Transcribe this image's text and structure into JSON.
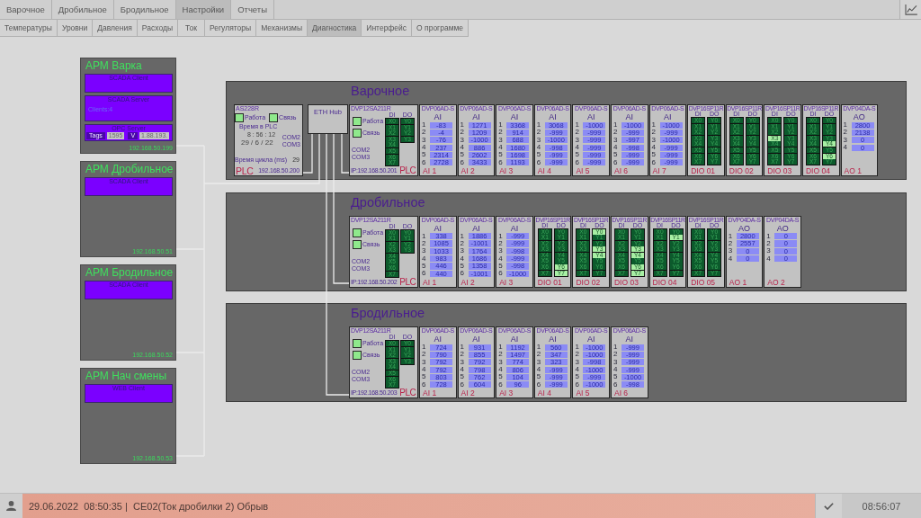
{
  "nav": {
    "tabs": [
      {
        "label": "Варочное",
        "selected": false
      },
      {
        "label": "Дробильное",
        "selected": false
      },
      {
        "label": "Бродильное",
        "selected": false
      },
      {
        "label": "Настройки",
        "selected": true
      },
      {
        "label": "Отчеты",
        "selected": false
      }
    ],
    "subtabs": [
      {
        "label": "Температуры",
        "selected": false
      },
      {
        "label": "Уровни",
        "selected": false
      },
      {
        "label": "Давления",
        "selected": false
      },
      {
        "label": "Расходы",
        "selected": false
      },
      {
        "label": "Ток",
        "selected": false
      },
      {
        "label": "Регуляторы",
        "selected": false
      },
      {
        "label": "Механизмы",
        "selected": false
      },
      {
        "label": "Диагностика",
        "selected": true
      },
      {
        "label": "Интерфейс",
        "selected": false
      },
      {
        "label": "О программе",
        "selected": false
      }
    ]
  },
  "workstations": [
    {
      "title": "АРМ Варка",
      "services": [
        {
          "kind": "basic",
          "name": "SCADA Client"
        },
        {
          "kind": "server",
          "name": "SCADA Server",
          "info": "Clients:4"
        },
        {
          "kind": "opc",
          "name": "OPC Server",
          "tags_label": "Tags",
          "tags": "1595",
          "version_label": "V",
          "version": "1.88.193."
        }
      ],
      "ip": "192.168.50.199"
    },
    {
      "title": "АРМ Дробильное",
      "services": [
        {
          "kind": "basic",
          "name": "SCADA Client"
        }
      ],
      "ip": "192.168.50.51"
    },
    {
      "title": "АРМ Бродильное",
      "services": [
        {
          "kind": "basic",
          "name": "SCADA Client"
        }
      ],
      "ip": "192.168.50.52"
    },
    {
      "title": "АРМ Нач смены",
      "services": [
        {
          "kind": "basic",
          "name": "WEB Client"
        }
      ],
      "ip": "192.168.50.53"
    }
  ],
  "sections": [
    {
      "title": "Варочное",
      "gateway": {
        "model": "AS228R",
        "statuses": [
          {
            "label": "Работа",
            "on": true
          },
          {
            "label": "Связь",
            "on": true
          }
        ],
        "clock_label": "Время в PLC",
        "time": "8 : 56 : 12",
        "date": "29 / 6 / 22",
        "ports": [
          "COM2",
          "COM3"
        ],
        "cycle_label": "Время цикла (ms)",
        "cycle": "29",
        "tag": "PLC",
        "ip": "192.168.50.200"
      },
      "hub": {
        "label": "ETH Hub"
      },
      "plc": {
        "model": "DVP12SA211R",
        "di_label": "DI",
        "do_label": "DO",
        "statuses": [
          {
            "label": "Работа",
            "on": true
          },
          {
            "label": "Связь",
            "on": true
          }
        ],
        "ports": [
          "COM2",
          "COM3"
        ],
        "inputs": [
          {
            "label": "X0",
            "on": false
          },
          {
            "label": "X1",
            "on": false
          },
          {
            "label": "X2",
            "on": false
          },
          {
            "label": "X3",
            "on": false
          },
          {
            "label": "X4",
            "on": false
          },
          {
            "label": "X5",
            "on": false
          },
          {
            "label": "X6",
            "on": false
          },
          {
            "label": "X7",
            "on": false
          }
        ],
        "outputs": [
          {
            "label": "Y0",
            "on": false
          },
          {
            "label": "Y1",
            "on": false
          },
          {
            "label": "Y2",
            "on": false
          },
          {
            "label": "Y3",
            "on": false
          }
        ],
        "ip": "IP:192.168.50.201",
        "tag": "PLC"
      },
      "modules": [
        {
          "kind": "analog",
          "model": "DVP06AD-S",
          "type": "AI",
          "channels": [
            {
              "n": "1",
              "value": "-83"
            },
            {
              "n": "2",
              "value": "-4"
            },
            {
              "n": "3",
              "value": "-76"
            },
            {
              "n": "4",
              "value": "237"
            },
            {
              "n": "5",
              "value": "2314"
            },
            {
              "n": "6",
              "value": "2728"
            }
          ],
          "label": "AI 1"
        },
        {
          "kind": "analog",
          "model": "DVP06AD-S",
          "type": "AI",
          "channels": [
            {
              "n": "1",
              "value": "1271"
            },
            {
              "n": "2",
              "value": "1209"
            },
            {
              "n": "3",
              "value": "-1000"
            },
            {
              "n": "4",
              "value": "886"
            },
            {
              "n": "5",
              "value": "2602"
            },
            {
              "n": "6",
              "value": "3433"
            }
          ],
          "label": "AI 2"
        },
        {
          "kind": "analog",
          "model": "DVP06AD-S",
          "type": "AI",
          "channels": [
            {
              "n": "1",
              "value": "3368"
            },
            {
              "n": "2",
              "value": "914"
            },
            {
              "n": "3",
              "value": "688"
            },
            {
              "n": "4",
              "value": "1680"
            },
            {
              "n": "5",
              "value": "1698"
            },
            {
              "n": "6",
              "value": "1193"
            }
          ],
          "label": "AI 3"
        },
        {
          "kind": "analog",
          "model": "DVP06AD-S",
          "type": "AI",
          "channels": [
            {
              "n": "1",
              "value": "3068"
            },
            {
              "n": "2",
              "value": "-999"
            },
            {
              "n": "3",
              "value": "-1000"
            },
            {
              "n": "4",
              "value": "-998"
            },
            {
              "n": "5",
              "value": "-999"
            },
            {
              "n": "6",
              "value": "-999"
            }
          ],
          "label": "AI 4"
        },
        {
          "kind": "analog",
          "model": "DVP06AD-S",
          "type": "AI",
          "channels": [
            {
              "n": "1",
              "value": "-1000"
            },
            {
              "n": "2",
              "value": "-999"
            },
            {
              "n": "3",
              "value": "-999"
            },
            {
              "n": "4",
              "value": "-999"
            },
            {
              "n": "5",
              "value": "-999"
            },
            {
              "n": "6",
              "value": "-999"
            }
          ],
          "label": "AI 5"
        },
        {
          "kind": "analog",
          "model": "DVP06AD-S",
          "type": "AI",
          "channels": [
            {
              "n": "1",
              "value": "-1000"
            },
            {
              "n": "2",
              "value": "-999"
            },
            {
              "n": "3",
              "value": "-997"
            },
            {
              "n": "4",
              "value": "-998"
            },
            {
              "n": "5",
              "value": "-999"
            },
            {
              "n": "6",
              "value": "-999"
            }
          ],
          "label": "AI 6"
        },
        {
          "kind": "analog",
          "model": "DVP06AD-S",
          "type": "AI",
          "channels": [
            {
              "n": "1",
              "value": "-1000"
            },
            {
              "n": "2",
              "value": "-999"
            },
            {
              "n": "3",
              "value": "-1000"
            },
            {
              "n": "4",
              "value": "-999"
            },
            {
              "n": "5",
              "value": "-999"
            },
            {
              "n": "6",
              "value": "-999"
            }
          ],
          "label": "AI 7"
        },
        {
          "kind": "digital",
          "model": "DVP16SP11R",
          "di_label": "DI",
          "do_label": "DO",
          "inputs": [
            {
              "label": "X0",
              "on": false
            },
            {
              "label": "X1",
              "on": false
            },
            {
              "label": "X2",
              "on": false
            },
            {
              "label": "X3",
              "on": false
            },
            {
              "label": "X4",
              "on": false
            },
            {
              "label": "X5",
              "on": false
            },
            {
              "label": "X6",
              "on": false
            },
            {
              "label": "X7",
              "on": false
            }
          ],
          "outputs": [
            {
              "label": "Y0",
              "on": false
            },
            {
              "label": "Y1",
              "on": false
            },
            {
              "label": "Y2",
              "on": false
            },
            {
              "label": "Y3",
              "on": false
            },
            {
              "label": "Y4",
              "on": false
            },
            {
              "label": "Y5",
              "on": false
            },
            {
              "label": "Y6",
              "on": false
            },
            {
              "label": "Y7",
              "on": false
            }
          ],
          "label": "DIO 01"
        },
        {
          "kind": "digital",
          "model": "DVP16SP11R",
          "di_label": "DI",
          "do_label": "DO",
          "inputs": [
            {
              "label": "X0",
              "on": false
            },
            {
              "label": "X1",
              "on": false
            },
            {
              "label": "X2",
              "on": false
            },
            {
              "label": "X3",
              "on": false
            },
            {
              "label": "X4",
              "on": false
            },
            {
              "label": "X5",
              "on": false
            },
            {
              "label": "X6",
              "on": false
            },
            {
              "label": "X7",
              "on": false
            }
          ],
          "outputs": [
            {
              "label": "Y0",
              "on": false
            },
            {
              "label": "Y1",
              "on": false
            },
            {
              "label": "Y2",
              "on": false
            },
            {
              "label": "Y3",
              "on": false
            },
            {
              "label": "Y4",
              "on": false
            },
            {
              "label": "Y5",
              "on": false
            },
            {
              "label": "Y6",
              "on": false
            },
            {
              "label": "Y7",
              "on": false
            }
          ],
          "label": "DIO 02"
        },
        {
          "kind": "digital",
          "model": "DVP16SP11R",
          "di_label": "DI",
          "do_label": "DO",
          "inputs": [
            {
              "label": "X0",
              "on": false
            },
            {
              "label": "X1",
              "on": false
            },
            {
              "label": "X2",
              "on": false
            },
            {
              "label": "X3",
              "on": true
            },
            {
              "label": "X4",
              "on": false
            },
            {
              "label": "X5",
              "on": false
            },
            {
              "label": "X6",
              "on": false
            },
            {
              "label": "X7",
              "on": false
            }
          ],
          "outputs": [
            {
              "label": "Y0",
              "on": false
            },
            {
              "label": "Y1",
              "on": false
            },
            {
              "label": "Y2",
              "on": false
            },
            {
              "label": "Y3",
              "on": false
            },
            {
              "label": "Y4",
              "on": false
            },
            {
              "label": "Y5",
              "on": false
            },
            {
              "label": "Y6",
              "on": false
            },
            {
              "label": "Y7",
              "on": false
            }
          ],
          "label": "DIO 03"
        },
        {
          "kind": "digital",
          "model": "DVP16SP11R",
          "di_label": "DI",
          "do_label": "DO",
          "inputs": [
            {
              "label": "X0",
              "on": false
            },
            {
              "label": "X1",
              "on": false
            },
            {
              "label": "X2",
              "on": false
            },
            {
              "label": "X3",
              "on": false
            },
            {
              "label": "X4",
              "on": false
            },
            {
              "label": "X5",
              "on": false
            },
            {
              "label": "X6",
              "on": false
            },
            {
              "label": "X7",
              "on": false
            }
          ],
          "outputs": [
            {
              "label": "Y0",
              "on": false
            },
            {
              "label": "Y1",
              "on": false
            },
            {
              "label": "Y2",
              "on": false
            },
            {
              "label": "Y3",
              "on": false
            },
            {
              "label": "Y4",
              "on": true
            },
            {
              "label": "Y5",
              "on": false
            },
            {
              "label": "Y6",
              "on": true
            },
            {
              "label": "Y7",
              "on": false
            }
          ],
          "label": "DIO 04"
        },
        {
          "kind": "analog",
          "model": "DVP04DA-S",
          "type": "AO",
          "channels": [
            {
              "n": "1",
              "value": "2800"
            },
            {
              "n": "2",
              "value": "2138"
            },
            {
              "n": "3",
              "value": "0"
            },
            {
              "n": "4",
              "value": "0"
            }
          ],
          "label": "AO 1"
        }
      ]
    },
    {
      "title": "Дробильное",
      "plc": {
        "model": "DVP12SA211R",
        "di_label": "DI",
        "do_label": "DO",
        "statuses": [
          {
            "label": "Работа",
            "on": true
          },
          {
            "label": "Связь",
            "on": true
          }
        ],
        "ports": [
          "COM2",
          "COM3"
        ],
        "inputs": [
          {
            "label": "X0",
            "on": false
          },
          {
            "label": "X1",
            "on": false
          },
          {
            "label": "X2",
            "on": false
          },
          {
            "label": "X3",
            "on": false
          },
          {
            "label": "X4",
            "on": false
          },
          {
            "label": "X5",
            "on": false
          },
          {
            "label": "X6",
            "on": false
          },
          {
            "label": "X7",
            "on": false
          }
        ],
        "outputs": [
          {
            "label": "Y0",
            "on": false
          },
          {
            "label": "Y1",
            "on": false
          },
          {
            "label": "Y2",
            "on": false
          },
          {
            "label": "Y3",
            "on": false
          }
        ],
        "ip": "IP:192.168.50.202",
        "tag": "PLC"
      },
      "modules": [
        {
          "kind": "analog",
          "model": "DVP06AD-S",
          "type": "AI",
          "channels": [
            {
              "n": "1",
              "value": "338"
            },
            {
              "n": "2",
              "value": "1085"
            },
            {
              "n": "3",
              "value": "1033"
            },
            {
              "n": "4",
              "value": "983"
            },
            {
              "n": "5",
              "value": "446"
            },
            {
              "n": "6",
              "value": "440"
            }
          ],
          "label": "AI 1"
        },
        {
          "kind": "analog",
          "model": "DVP06AD-S",
          "type": "AI",
          "channels": [
            {
              "n": "1",
              "value": "1886"
            },
            {
              "n": "2",
              "value": "-1001"
            },
            {
              "n": "3",
              "value": "1764"
            },
            {
              "n": "4",
              "value": "1686"
            },
            {
              "n": "5",
              "value": "1358"
            },
            {
              "n": "6",
              "value": "-1001"
            }
          ],
          "label": "AI 2"
        },
        {
          "kind": "analog",
          "model": "DVP06AD-S",
          "type": "AI",
          "channels": [
            {
              "n": "1",
              "value": "-999"
            },
            {
              "n": "2",
              "value": "-999"
            },
            {
              "n": "3",
              "value": "-998"
            },
            {
              "n": "4",
              "value": "-999"
            },
            {
              "n": "5",
              "value": "-998"
            },
            {
              "n": "6",
              "value": "-1000"
            }
          ],
          "label": "AI 3"
        },
        {
          "kind": "digital",
          "model": "DVP16SP11R",
          "di_label": "DI",
          "do_label": "DO",
          "inputs": [
            {
              "label": "X0",
              "on": false
            },
            {
              "label": "X1",
              "on": false
            },
            {
              "label": "X2",
              "on": false
            },
            {
              "label": "X3",
              "on": false
            },
            {
              "label": "X4",
              "on": false
            },
            {
              "label": "X5",
              "on": false
            },
            {
              "label": "X6",
              "on": false
            },
            {
              "label": "X7",
              "on": false
            }
          ],
          "outputs": [
            {
              "label": "Y0",
              "on": false
            },
            {
              "label": "Y1",
              "on": false
            },
            {
              "label": "Y2",
              "on": false
            },
            {
              "label": "Y3",
              "on": false
            },
            {
              "label": "Y4",
              "on": false
            },
            {
              "label": "Y5",
              "on": false
            },
            {
              "label": "Y6",
              "on": true
            },
            {
              "label": "Y7",
              "on": true
            }
          ],
          "label": "DIO 01"
        },
        {
          "kind": "digital",
          "model": "DVP16SP11R",
          "di_label": "DI",
          "do_label": "DO",
          "inputs": [
            {
              "label": "X0",
              "on": false
            },
            {
              "label": "X1",
              "on": false
            },
            {
              "label": "X2",
              "on": false
            },
            {
              "label": "X3",
              "on": false
            },
            {
              "label": "X4",
              "on": false
            },
            {
              "label": "X5",
              "on": false
            },
            {
              "label": "X6",
              "on": false
            },
            {
              "label": "X7",
              "on": false
            }
          ],
          "outputs": [
            {
              "label": "Y0",
              "on": true
            },
            {
              "label": "Y1",
              "on": false
            },
            {
              "label": "Y2",
              "on": false
            },
            {
              "label": "Y3",
              "on": true
            },
            {
              "label": "Y4",
              "on": true
            },
            {
              "label": "Y5",
              "on": false
            },
            {
              "label": "Y6",
              "on": false
            },
            {
              "label": "Y7",
              "on": false
            }
          ],
          "label": "DIO 02"
        },
        {
          "kind": "digital",
          "model": "DVP16SP11R",
          "di_label": "DI",
          "do_label": "DO",
          "inputs": [
            {
              "label": "X0",
              "on": false
            },
            {
              "label": "X1",
              "on": false
            },
            {
              "label": "X2",
              "on": false
            },
            {
              "label": "X3",
              "on": false
            },
            {
              "label": "X4",
              "on": false
            },
            {
              "label": "X5",
              "on": false
            },
            {
              "label": "X6",
              "on": false
            },
            {
              "label": "X7",
              "on": false
            }
          ],
          "outputs": [
            {
              "label": "Y0",
              "on": false
            },
            {
              "label": "Y1",
              "on": false
            },
            {
              "label": "Y2",
              "on": false
            },
            {
              "label": "Y3",
              "on": true
            },
            {
              "label": "Y4",
              "on": true
            },
            {
              "label": "Y5",
              "on": false
            },
            {
              "label": "Y6",
              "on": true
            },
            {
              "label": "Y7",
              "on": true
            }
          ],
          "label": "DIO 03"
        },
        {
          "kind": "digital",
          "model": "DVP16SP11R",
          "di_label": "DI",
          "do_label": "DO",
          "inputs": [
            {
              "label": "X0",
              "on": false
            },
            {
              "label": "X1",
              "on": false
            },
            {
              "label": "X2",
              "on": false
            },
            {
              "label": "X3",
              "on": false
            },
            {
              "label": "X4",
              "on": false
            },
            {
              "label": "X5",
              "on": false
            },
            {
              "label": "X6",
              "on": false
            },
            {
              "label": "X7",
              "on": false
            }
          ],
          "outputs": [
            {
              "label": "Y0",
              "on": false
            },
            {
              "label": "Y1",
              "on": true
            },
            {
              "label": "Y2",
              "on": false
            },
            {
              "label": "Y3",
              "on": false
            },
            {
              "label": "Y4",
              "on": false
            },
            {
              "label": "Y5",
              "on": false
            },
            {
              "label": "Y6",
              "on": false
            },
            {
              "label": "Y7",
              "on": false
            }
          ],
          "label": "DIO 04"
        },
        {
          "kind": "digital",
          "model": "DVP16SP11R",
          "di_label": "DI",
          "do_label": "DO",
          "inputs": [
            {
              "label": "X0",
              "on": false
            },
            {
              "label": "X1",
              "on": false
            },
            {
              "label": "X2",
              "on": false
            },
            {
              "label": "X3",
              "on": false
            },
            {
              "label": "X4",
              "on": false
            },
            {
              "label": "X5",
              "on": false
            },
            {
              "label": "X6",
              "on": false
            },
            {
              "label": "X7",
              "on": false
            }
          ],
          "outputs": [
            {
              "label": "Y0",
              "on": false
            },
            {
              "label": "Y1",
              "on": false
            },
            {
              "label": "Y2",
              "on": false
            },
            {
              "label": "Y3",
              "on": false
            },
            {
              "label": "Y4",
              "on": false
            },
            {
              "label": "Y5",
              "on": false
            },
            {
              "label": "Y6",
              "on": false
            },
            {
              "label": "Y7",
              "on": false
            }
          ],
          "label": "DIO 05"
        },
        {
          "kind": "analog",
          "model": "DVP04DA-S",
          "type": "AO",
          "channels": [
            {
              "n": "1",
              "value": "2800"
            },
            {
              "n": "2",
              "value": "2557"
            },
            {
              "n": "3",
              "value": "0"
            },
            {
              "n": "4",
              "value": "0"
            }
          ],
          "label": "AO 1"
        },
        {
          "kind": "analog",
          "model": "DVP04DA-S",
          "type": "AO",
          "channels": [
            {
              "n": "1",
              "value": "0"
            },
            {
              "n": "2",
              "value": "0"
            },
            {
              "n": "3",
              "value": "0"
            },
            {
              "n": "4",
              "value": "0"
            }
          ],
          "label": "AO 2"
        }
      ]
    },
    {
      "title": "Бродильное",
      "plc": {
        "model": "DVP12SA211R",
        "di_label": "DI",
        "do_label": "DO",
        "statuses": [
          {
            "label": "Работа",
            "on": true
          },
          {
            "label": "Связь",
            "on": true
          }
        ],
        "ports": [
          "COM2",
          "COM3"
        ],
        "inputs": [
          {
            "label": "X0",
            "on": false
          },
          {
            "label": "X1",
            "on": false
          },
          {
            "label": "X2",
            "on": false
          },
          {
            "label": "X3",
            "on": false
          },
          {
            "label": "X4",
            "on": false
          },
          {
            "label": "X5",
            "on": false
          },
          {
            "label": "X6",
            "on": false
          },
          {
            "label": "X7",
            "on": false
          }
        ],
        "outputs": [
          {
            "label": "Y0",
            "on": false
          },
          {
            "label": "Y1",
            "on": false
          },
          {
            "label": "Y2",
            "on": false
          },
          {
            "label": "Y3",
            "on": false
          }
        ],
        "ip": "IP:192.168.50.203",
        "tag": "PLC"
      },
      "modules": [
        {
          "kind": "analog",
          "model": "DVP06AD-S",
          "type": "AI",
          "channels": [
            {
              "n": "1",
              "value": "724"
            },
            {
              "n": "2",
              "value": "790"
            },
            {
              "n": "3",
              "value": "792"
            },
            {
              "n": "4",
              "value": "792"
            },
            {
              "n": "5",
              "value": "803"
            },
            {
              "n": "6",
              "value": "728"
            }
          ],
          "label": "AI 1"
        },
        {
          "kind": "analog",
          "model": "DVP06AD-S",
          "type": "AI",
          "channels": [
            {
              "n": "1",
              "value": "931"
            },
            {
              "n": "2",
              "value": "855"
            },
            {
              "n": "3",
              "value": "792"
            },
            {
              "n": "4",
              "value": "798"
            },
            {
              "n": "5",
              "value": "762"
            },
            {
              "n": "6",
              "value": "604"
            }
          ],
          "label": "AI 2"
        },
        {
          "kind": "analog",
          "model": "DVP06AD-S",
          "type": "AI",
          "channels": [
            {
              "n": "1",
              "value": "1192"
            },
            {
              "n": "2",
              "value": "1497"
            },
            {
              "n": "3",
              "value": "774"
            },
            {
              "n": "4",
              "value": "806"
            },
            {
              "n": "5",
              "value": "104"
            },
            {
              "n": "6",
              "value": "96"
            }
          ],
          "label": "AI 3"
        },
        {
          "kind": "analog",
          "model": "DVP06AD-S",
          "type": "AI",
          "channels": [
            {
              "n": "1",
              "value": "560"
            },
            {
              "n": "2",
              "value": "347"
            },
            {
              "n": "3",
              "value": "323"
            },
            {
              "n": "4",
              "value": "-999"
            },
            {
              "n": "5",
              "value": "-999"
            },
            {
              "n": "6",
              "value": "-999"
            }
          ],
          "label": "AI 4"
        },
        {
          "kind": "analog",
          "model": "DVP06AD-S",
          "type": "AI",
          "channels": [
            {
              "n": "1",
              "value": "-1000"
            },
            {
              "n": "2",
              "value": "-1000"
            },
            {
              "n": "3",
              "value": "-998"
            },
            {
              "n": "4",
              "value": "-1000"
            },
            {
              "n": "5",
              "value": "-999"
            },
            {
              "n": "6",
              "value": "-1000"
            }
          ],
          "label": "AI 5"
        },
        {
          "kind": "analog",
          "model": "DVP06AD-S",
          "type": "AI",
          "channels": [
            {
              "n": "1",
              "value": "-999"
            },
            {
              "n": "2",
              "value": "-999"
            },
            {
              "n": "3",
              "value": "-999"
            },
            {
              "n": "4",
              "value": "-999"
            },
            {
              "n": "5",
              "value": "-1000"
            },
            {
              "n": "6",
              "value": "-998"
            }
          ],
          "label": "AI 6"
        }
      ]
    }
  ],
  "status_bar": {
    "alarm": "29.06.2022  08:50:35 |  CE02(Ток дробилки 2) Обрыв",
    "time": "08:56:07"
  }
}
